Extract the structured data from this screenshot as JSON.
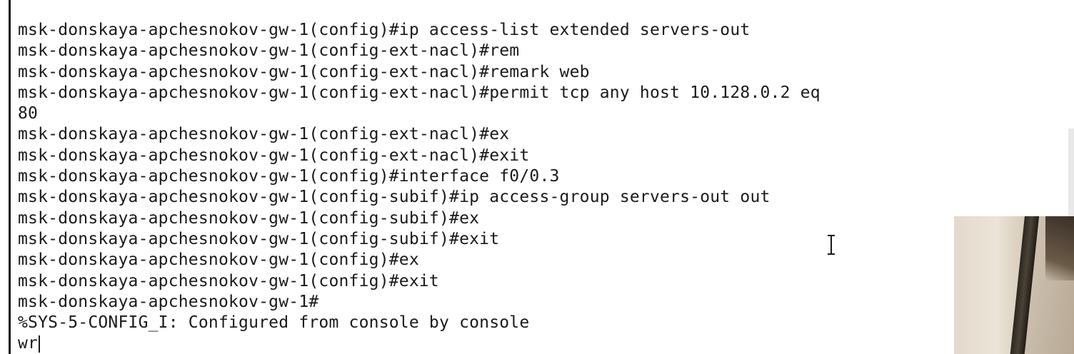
{
  "terminal": {
    "lines": [
      "msk-donskaya-apchesnokov-gw-1(config)#ip access-list extended servers-out",
      "msk-donskaya-apchesnokov-gw-1(config-ext-nacl)#rem",
      "msk-donskaya-apchesnokov-gw-1(config-ext-nacl)#remark web",
      "msk-donskaya-apchesnokov-gw-1(config-ext-nacl)#permit tcp any host 10.128.0.2 eq",
      "80",
      "msk-donskaya-apchesnokov-gw-1(config-ext-nacl)#ex",
      "msk-donskaya-apchesnokov-gw-1(config-ext-nacl)#exit",
      "msk-donskaya-apchesnokov-gw-1(config)#interface f0/0.3",
      "msk-donskaya-apchesnokov-gw-1(config-subif)#ip access-group servers-out out",
      "msk-donskaya-apchesnokov-gw-1(config-subif)#ex",
      "msk-donskaya-apchesnokov-gw-1(config-subif)#exit",
      "msk-donskaya-apchesnokov-gw-1(config)#ex",
      "msk-donskaya-apchesnokov-gw-1(config)#exit",
      "msk-donskaya-apchesnokov-gw-1#",
      "%SYS-5-CONFIG_I: Configured from console by console"
    ],
    "current_input": "wr"
  },
  "icons": {
    "text_cursor": "i-beam-cursor-icon"
  },
  "colors": {
    "background": "#ffffff",
    "text": "#1a1a1a",
    "border": "#111111"
  }
}
